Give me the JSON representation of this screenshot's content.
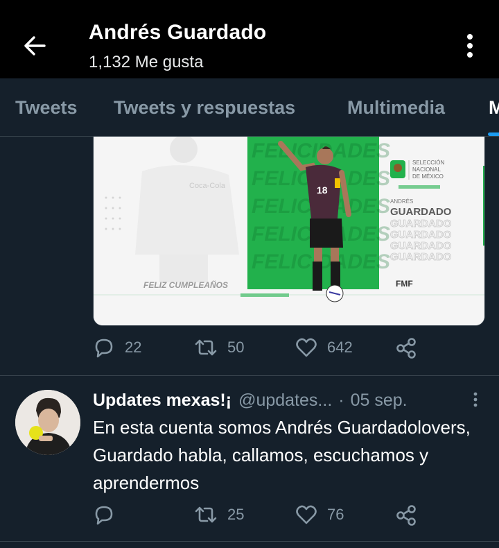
{
  "header": {
    "title": "Andrés Guardado",
    "subtitle": "1,132 Me gusta"
  },
  "tabs": [
    {
      "label": "Tweets"
    },
    {
      "label": "Tweets y respuestas"
    },
    {
      "label": "Multimedia"
    },
    {
      "label": "M"
    }
  ],
  "media_card": {
    "crest_text": [
      "SELECCIÓN",
      "NACIONAL",
      "DE MÉXICO"
    ],
    "name_small": "ANDRÉS",
    "name_big": "GUARDADO",
    "name_repeat": "GUARDADO",
    "greeting": "FELIZ CUMPLEAÑOS",
    "badge": "FMF",
    "jersey_number": "18",
    "sponsor": "Coca-Cola"
  },
  "tweet1_actions": {
    "replies": "22",
    "retweets": "50",
    "likes": "642"
  },
  "tweet2": {
    "name": "Updates mexas!¡",
    "handle": "@updates...",
    "separator": "·",
    "date": "05 sep.",
    "text": "En esta cuenta somos Andrés Guardadolovers, Guardado habla, callamos, escuchamos y aprendermos",
    "replies": "",
    "retweets": "25",
    "likes": "76"
  },
  "colors": {
    "background": "#15202b",
    "topbar": "#000000",
    "muted": "#8899a6",
    "accent": "#1d9bf0",
    "green": "#22b14c"
  }
}
